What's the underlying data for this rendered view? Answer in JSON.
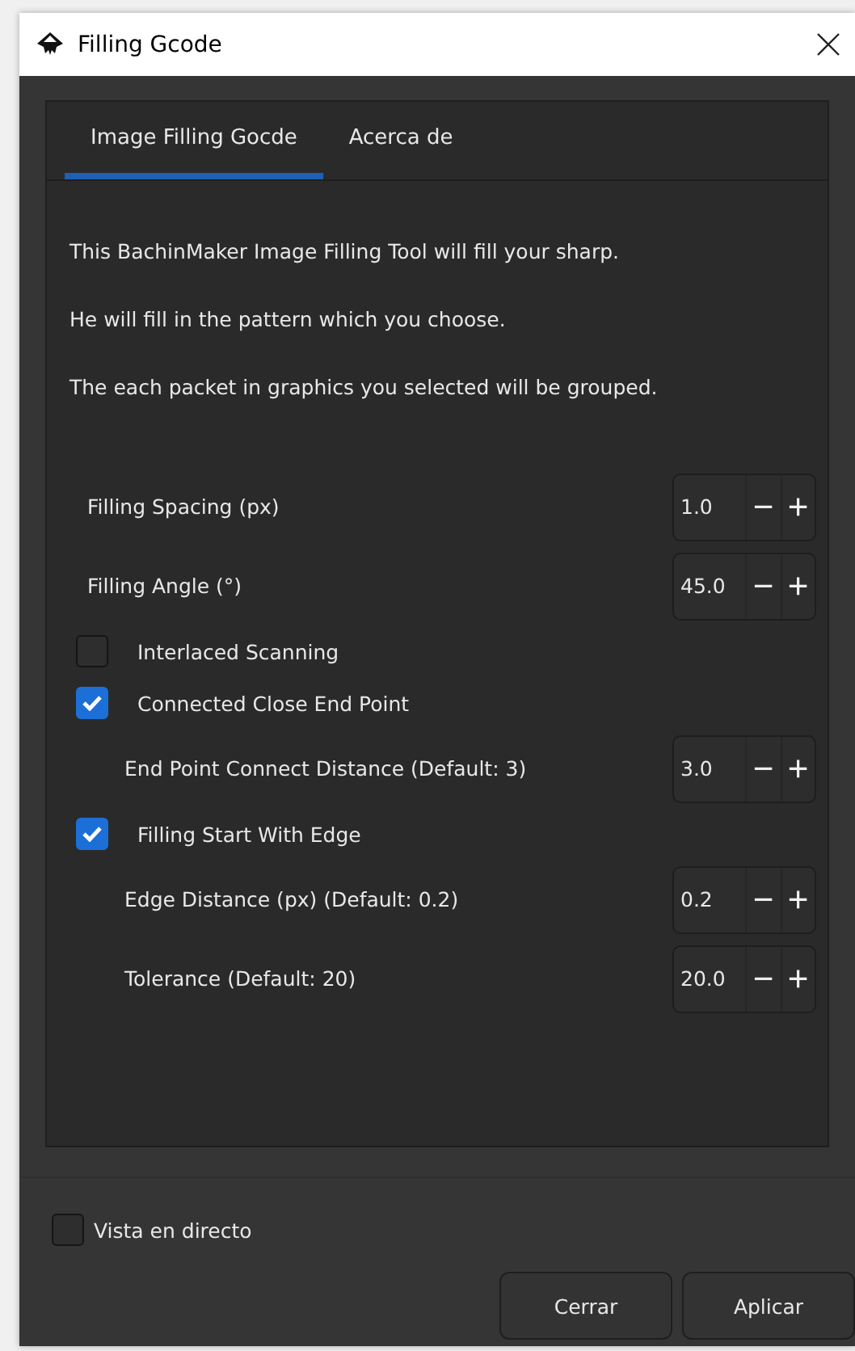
{
  "window": {
    "title": "Filling Gcode"
  },
  "tabs": [
    {
      "label": "Image Filling Gocde",
      "selected": true
    },
    {
      "label": "Acerca de",
      "selected": false
    }
  ],
  "description": [
    "This BachinMaker Image Filling Tool will fill your sharp.",
    "He will fill in the pattern which you choose.",
    "The each packet in graphics you selected will be grouped."
  ],
  "options": [
    {
      "kind": "spin",
      "label": "Filling Spacing (px)",
      "value": "1.0",
      "minus": "−",
      "plus": "+"
    },
    {
      "kind": "spin",
      "label": "Filling Angle (°)",
      "value": "45.0",
      "minus": "−",
      "plus": "+"
    },
    {
      "kind": "check",
      "label": "Interlaced Scanning",
      "checked": false
    },
    {
      "kind": "check",
      "label": "Connected Close End Point",
      "checked": true
    },
    {
      "kind": "subspin",
      "label": "End Point Connect Distance (Default: 3)",
      "value": "3.0",
      "minus": "−",
      "plus": "+"
    },
    {
      "kind": "check",
      "label": "Filling Start With Edge",
      "checked": true
    },
    {
      "kind": "subspin",
      "label": "Edge Distance (px) (Default: 0.2)",
      "value": "0.2",
      "minus": "−",
      "plus": "+"
    },
    {
      "kind": "subspin",
      "label": "Tolerance (Default: 20)",
      "value": "20.0",
      "minus": "−",
      "plus": "+"
    }
  ],
  "live_preview": {
    "label": "Vista en directo",
    "checked": false
  },
  "buttons": [
    "Cerrar",
    "Aplicar"
  ]
}
